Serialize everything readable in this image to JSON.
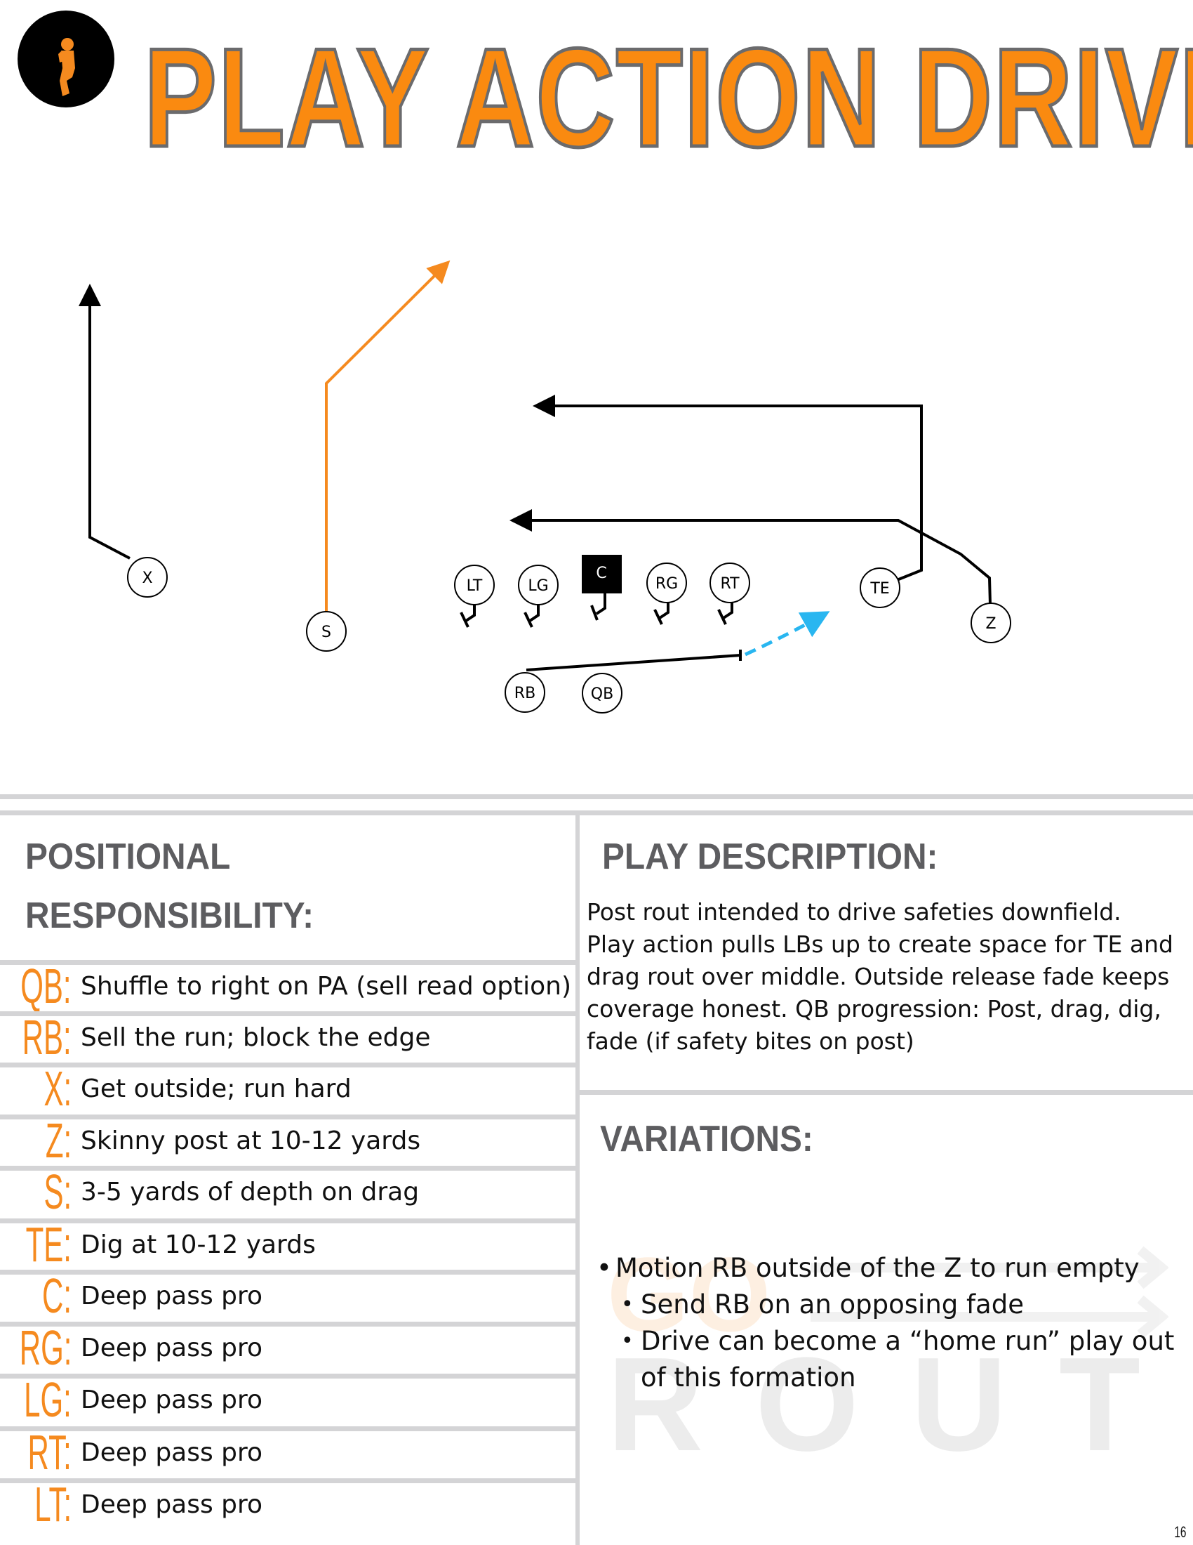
{
  "header": {
    "title": "PLAY ACTION DRIVE",
    "logo": "quarterback-logo",
    "title_color": "#fa8a10",
    "title_outline_color": "#6b6b6d"
  },
  "diagram": {
    "players": [
      {
        "id": "X",
        "label": "X",
        "shape": "circle"
      },
      {
        "id": "S",
        "label": "S",
        "shape": "circle"
      },
      {
        "id": "LT",
        "label": "LT",
        "shape": "circle"
      },
      {
        "id": "LG",
        "label": "LG",
        "shape": "circle"
      },
      {
        "id": "C",
        "label": "C",
        "shape": "square"
      },
      {
        "id": "RG",
        "label": "RG",
        "shape": "circle"
      },
      {
        "id": "RT",
        "label": "RT",
        "shape": "circle"
      },
      {
        "id": "TE",
        "label": "TE",
        "shape": "circle"
      },
      {
        "id": "Z",
        "label": "Z",
        "shape": "circle"
      },
      {
        "id": "RB",
        "label": "RB",
        "shape": "circle"
      },
      {
        "id": "QB",
        "label": "QB",
        "shape": "circle"
      }
    ],
    "routes": [
      {
        "player": "X",
        "type": "go",
        "color": "#000000",
        "style": "solid"
      },
      {
        "player": "S",
        "type": "post",
        "color": "#f58a1f",
        "style": "solid"
      },
      {
        "player": "TE",
        "type": "dig",
        "color": "#000000",
        "style": "solid"
      },
      {
        "player": "Z",
        "type": "drag",
        "color": "#000000",
        "style": "solid"
      },
      {
        "player": "RB",
        "type": "fake-then-release",
        "color": "#000000",
        "style": "solid"
      },
      {
        "player": "RB",
        "type": "release",
        "color": "#29b6f0",
        "style": "dashed"
      }
    ]
  },
  "positional": {
    "heading_line1": "POSITIONAL",
    "heading_line2": "RESPONSIBILITY:",
    "rows": [
      {
        "pos": "QB:",
        "text": "Shuffle to right on PA (sell read option)"
      },
      {
        "pos": "RB:",
        "text": "Sell the run; block the edge"
      },
      {
        "pos": "X:",
        "text": "Get outside; run hard"
      },
      {
        "pos": "Z:",
        "text": "Skinny post at 10-12 yards"
      },
      {
        "pos": "S:",
        "text": "3-5 yards of depth on drag"
      },
      {
        "pos": "TE:",
        "text": "Dig at 10-12 yards"
      },
      {
        "pos": "C:",
        "text": "Deep pass pro"
      },
      {
        "pos": "RG:",
        "text": "Deep pass pro"
      },
      {
        "pos": "LG:",
        "text": "Deep pass pro"
      },
      {
        "pos": "RT:",
        "text": "Deep pass pro"
      },
      {
        "pos": "LT:",
        "text": "Deep pass pro"
      }
    ]
  },
  "description": {
    "heading": "PLAY DESCRIPTION:",
    "text": "Post rout intended to drive safeties downfield. Play action pulls LBs up to create space for TE and drag rout over middle. Outside release fade keeps coverage honest. QB progression: Post, drag, dig, fade (if safety bites on post)"
  },
  "variations": {
    "heading": "VARIATIONS:",
    "items": [
      {
        "level": 1,
        "text": "Motion RB outside of the Z to run empty"
      },
      {
        "level": 2,
        "text": "Send RB on an opposing fade"
      },
      {
        "level": 2,
        "text": "Drive can become a “home run” play out of this formation"
      }
    ]
  },
  "watermark": {
    "line1": "GO",
    "line2": "ROUT"
  },
  "page_number": "16"
}
